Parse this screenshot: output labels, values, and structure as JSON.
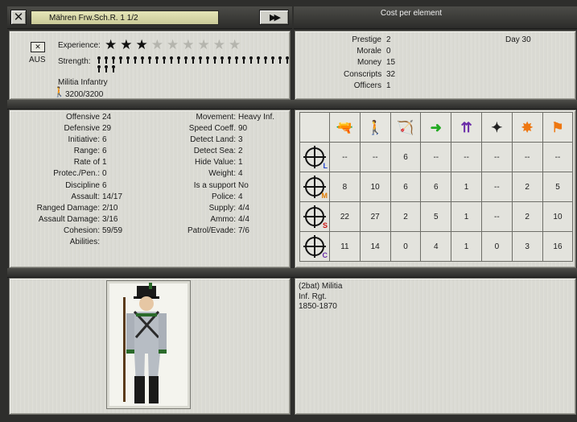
{
  "header": {
    "close_label": "✕",
    "unit_name": "Mähren Frw.Sch.R. 1 1/2",
    "next_label": "▶▶",
    "cost_title": "Cost per element"
  },
  "identity": {
    "nation": "AUS",
    "experience_label": "Experience:",
    "experience_stars": 3,
    "experience_max": 9,
    "strength_label": "Strength:",
    "strength_figures": 30,
    "unit_type": "Militia Infantry",
    "hits": "3200/3200"
  },
  "cost": {
    "rows": [
      {
        "label": "Prestige",
        "value": "2"
      },
      {
        "label": "Morale",
        "value": "0"
      },
      {
        "label": "Money",
        "value": "15"
      },
      {
        "label": "Conscripts",
        "value": "32"
      },
      {
        "label": "Officers",
        "value": "1"
      }
    ],
    "day": "Day 30"
  },
  "stats_left": [
    {
      "label": "Offensive",
      "value": "24"
    },
    {
      "label": "Defensive",
      "value": "29"
    },
    {
      "label": "Initiative:",
      "value": "6"
    },
    {
      "label": "Range:",
      "value": "6"
    },
    {
      "label": "Rate of",
      "value": "1"
    },
    {
      "label": "Protec./Pen.:",
      "value": "0"
    },
    {
      "label": "Discipline",
      "value": "6"
    },
    {
      "label": "Assault:",
      "value": "14/17"
    },
    {
      "label": "Ranged Damage:",
      "value": "2/10"
    },
    {
      "label": "Assault Damage:",
      "value": "3/16"
    },
    {
      "label": "Cohesion:",
      "value": "59/59"
    },
    {
      "label": "Abilities:",
      "value": ""
    }
  ],
  "stats_right": [
    {
      "label": "Movement:",
      "value": "Heavy Inf."
    },
    {
      "label": "Speed Coeff.",
      "value": "90"
    },
    {
      "label": "Detect Land:",
      "value": "3"
    },
    {
      "label": "Detect Sea:",
      "value": "2"
    },
    {
      "label": "Hide Value:",
      "value": "1"
    },
    {
      "label": "Weight:",
      "value": "4"
    },
    {
      "label": "Is a support",
      "value": "No"
    },
    {
      "label": "Police:",
      "value": "4"
    },
    {
      "label": "Supply:",
      "value": "4/4"
    },
    {
      "label": "Ammo:",
      "value": "4/4"
    },
    {
      "label": "Patrol/Evade:",
      "value": "7/6"
    }
  ],
  "table": {
    "column_icons": [
      "infantry-fire-icon",
      "infantry-icon",
      "artillery-icon",
      "move-arrow-icon",
      "split-arrows-icon",
      "skirmish-icon",
      "explosion-icon",
      "flag-icon"
    ],
    "rows": [
      {
        "letter": "L",
        "letter_color": "#2244cc",
        "values": [
          "--",
          "--",
          "6",
          "--",
          "--",
          "--",
          "--",
          "--"
        ]
      },
      {
        "letter": "M",
        "letter_color": "#e07b00",
        "values": [
          "8",
          "10",
          "6",
          "6",
          "1",
          "--",
          "2",
          "5"
        ]
      },
      {
        "letter": "S",
        "letter_color": "#cc1111",
        "values": [
          "22",
          "27",
          "2",
          "5",
          "1",
          "--",
          "2",
          "10"
        ]
      },
      {
        "letter": "C",
        "letter_color": "#6a2ca8",
        "values": [
          "11",
          "14",
          "0",
          "4",
          "1",
          "0",
          "3",
          "16"
        ]
      }
    ]
  },
  "description": {
    "line1": "(2bat) Militia",
    "line2": "Inf. Rgt.",
    "line3": "1850-1870"
  }
}
